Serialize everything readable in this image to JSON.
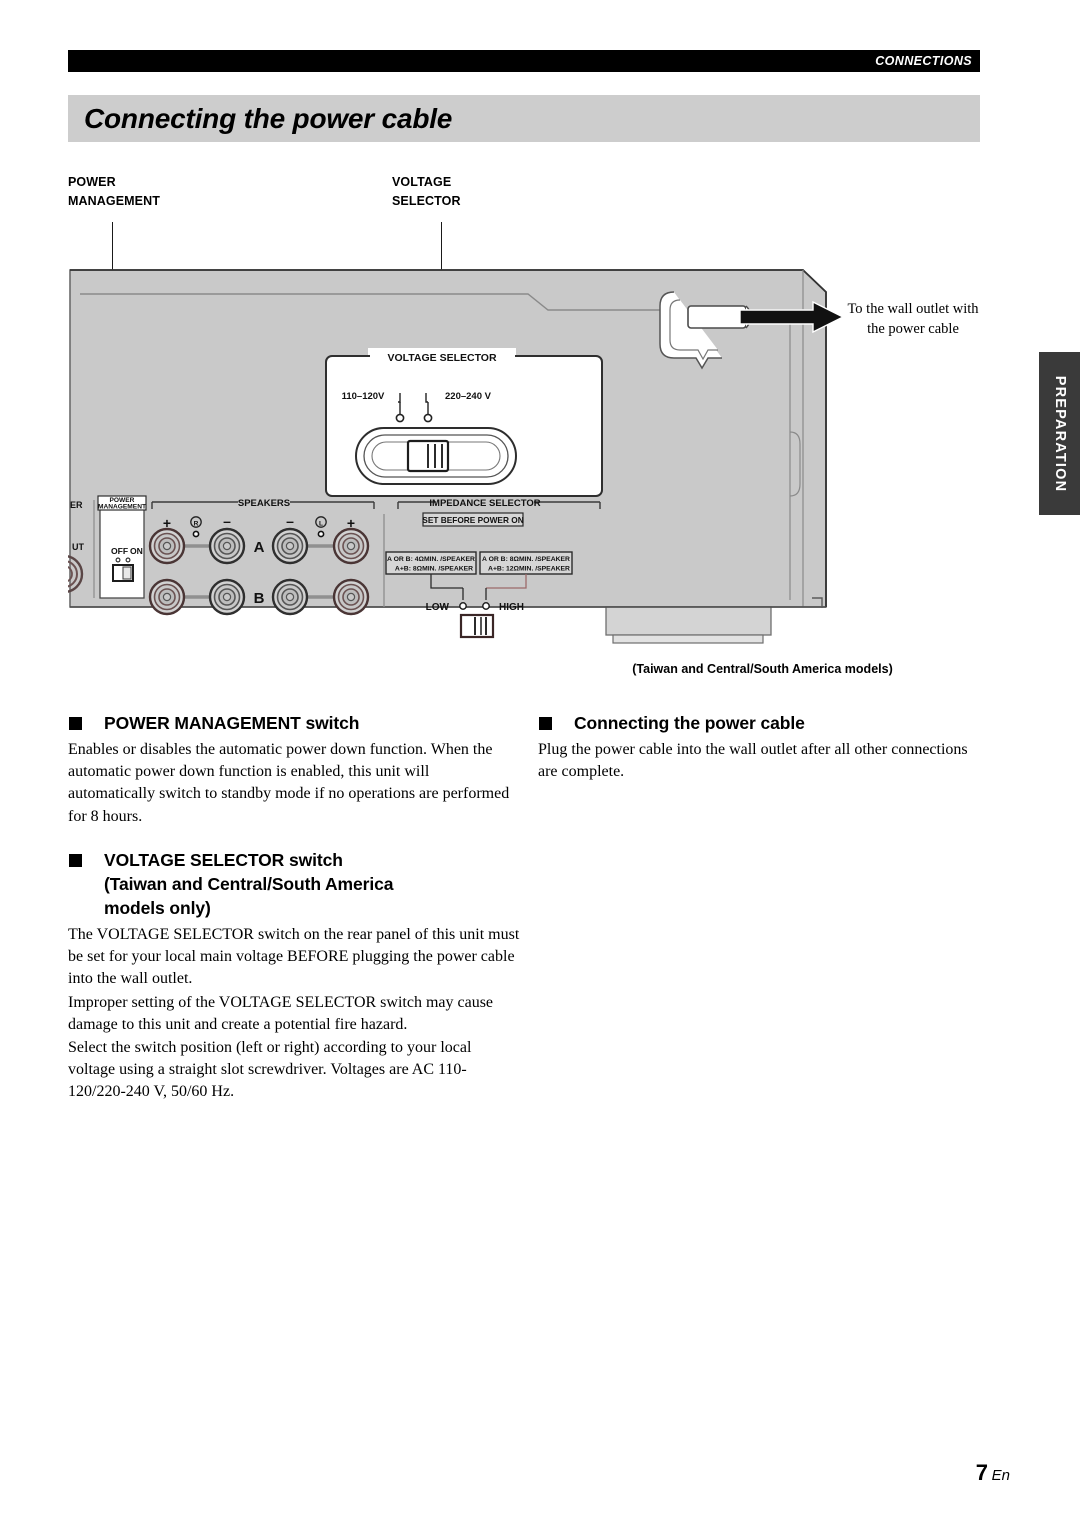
{
  "header": {
    "chapter": "CONNECTIONS",
    "title": "Connecting the power cable"
  },
  "side_tab": {
    "label": "PREPARATION"
  },
  "diagram": {
    "callout_power_management": "POWER\nMANAGEMENT",
    "callout_power_management_l1": "POWER",
    "callout_power_management_l2": "MANAGEMENT",
    "callout_voltage_selector_l1": "VOLTAGE",
    "callout_voltage_selector_l2": "SELECTOR",
    "wall_outlet_note_l1": "To the wall outlet with",
    "wall_outlet_note_l2": "the power cable",
    "caption": "(Taiwan and Central/South America models)",
    "panel": {
      "voltage_selector_title": "VOLTAGE SELECTOR",
      "voltage_low_label": "110–120V",
      "voltage_high_label": "220–240 V",
      "power_management_title_l1": "POWER",
      "power_management_title_l2": "MANAGEMENT",
      "power_management_off": "OFF",
      "power_management_on": "ON",
      "speakers_title": "SPEAKERS",
      "speaker_plus_left": "+",
      "speaker_minus_left": "–",
      "speaker_minus_right": "–",
      "speaker_plus_right": "+",
      "channel_right": "R",
      "channel_left": "L",
      "row_a": "A",
      "row_b": "B",
      "impedance_title": "IMPEDANCE SELECTOR",
      "impedance_note": "SET BEFORE POWER ON",
      "impedance_low_box_l1": "A OR B: 4ΩMIN. /SPEAKER",
      "impedance_low_box_l2": "A+B: 8ΩMIN. /SPEAKER",
      "impedance_high_box_l1": "A OR B: 8ΩMIN. /SPEAKER",
      "impedance_high_box_l2": "A+B: 12ΩMIN. /SPEAKER",
      "impedance_low_label": "LOW",
      "impedance_high_label": "HIGH",
      "edge_label_er": "ER",
      "edge_label_ut": "UT"
    }
  },
  "sections": {
    "power_management": {
      "heading": "POWER MANAGEMENT switch",
      "paragraphs": [
        "Enables or disables the automatic power down function. When the automatic power down function is enabled, this unit will automatically switch to standby mode if no operations are performed for 8 hours."
      ]
    },
    "voltage_selector": {
      "heading_l1": "VOLTAGE SELECTOR switch",
      "heading_l2": "(Taiwan and Central/South America",
      "heading_l3": "models only)",
      "paragraphs": [
        "The VOLTAGE SELECTOR switch on the rear panel of this unit must be set for your local main voltage BEFORE plugging the power cable into the wall outlet.",
        "Improper setting of the VOLTAGE SELECTOR switch may cause damage to this unit and create a potential fire hazard.",
        "Select the switch position (left or right) according to your local voltage using a straight slot screwdriver. Voltages are AC 110-120/220-240 V, 50/60 Hz."
      ]
    },
    "connecting_power_cable": {
      "heading": "Connecting the power cable",
      "paragraphs": [
        "Plug the power cable into the wall outlet after all other connections are complete."
      ]
    }
  },
  "footer": {
    "page_number": "7",
    "language": "En"
  },
  "colors": {
    "header_band": "#000000",
    "title_bar": "#cdcdcd",
    "side_tab": "#3a3a3a",
    "panel_fill": "#c9c9c9"
  }
}
